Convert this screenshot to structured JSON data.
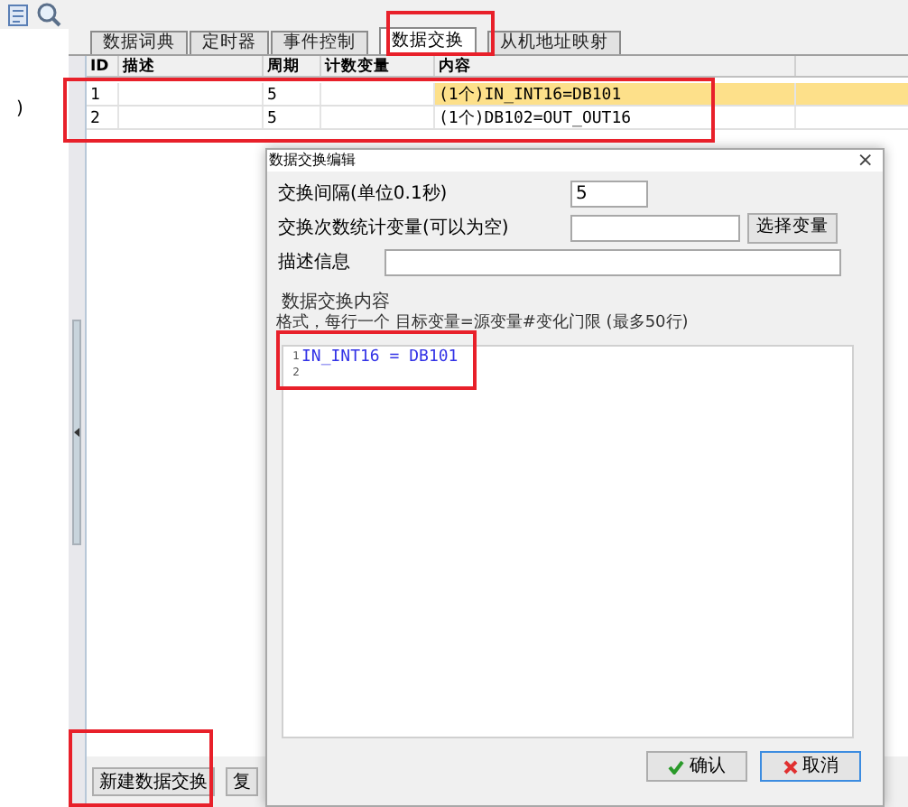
{
  "left_panel": {
    "text": ")"
  },
  "tabs": [
    {
      "label": "数据词典",
      "selected": false
    },
    {
      "label": "定时器",
      "selected": false
    },
    {
      "label": "事件控制",
      "selected": false
    },
    {
      "label": "数据交换",
      "selected": true
    },
    {
      "label": "从机地址映射",
      "selected": false
    }
  ],
  "table": {
    "columns": [
      "ID",
      "描述",
      "周期",
      "计数变量",
      "内容"
    ],
    "rows": [
      {
        "cells": [
          "1",
          "",
          "5",
          "",
          "(1个)IN_INT16=DB101"
        ],
        "selected": true
      },
      {
        "cells": [
          "2",
          "",
          "5",
          "",
          "(1个)DB102=OUT_OUT16"
        ],
        "selected": false
      }
    ]
  },
  "bottom_buttons": [
    "新建数据交换",
    "复"
  ],
  "dialog": {
    "title": "数据交换编辑",
    "close": "×",
    "interval_label": "交换间隔(单位0.1秒)",
    "interval_value": "5",
    "counter_label": "交换次数统计变量(可以为空)",
    "select_button": "选择变量",
    "desc_label": "描述信息",
    "group_title": "数据交换内容",
    "format_hint": "格式，每行一个 目标变量=源变量#变化门限 (最多50行)",
    "lines": [
      {
        "number": "1",
        "text": "IN_INT16 = DB101"
      },
      {
        "number": "2"
      }
    ],
    "ok_button": "确认",
    "cancel_button": "取消"
  }
}
